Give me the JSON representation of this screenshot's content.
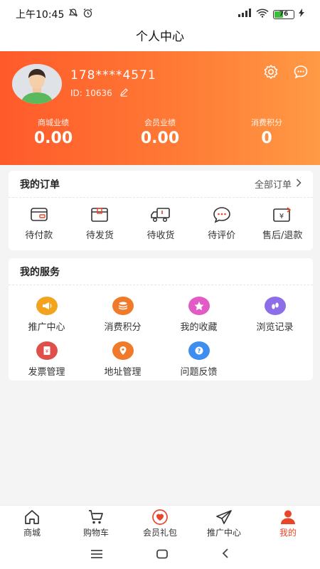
{
  "status_bar": {
    "time": "上午10:45",
    "battery": "76"
  },
  "title": "个人中心",
  "profile": {
    "phone": "178****4571",
    "id_label": "ID: 10636"
  },
  "stats": [
    {
      "label": "商城业绩",
      "value": "0.00"
    },
    {
      "label": "会员业绩",
      "value": "0.00"
    },
    {
      "label": "消费积分",
      "value": "0"
    }
  ],
  "orders": {
    "title": "我的订单",
    "all_label": "全部订单",
    "items": [
      {
        "label": "待付款",
        "icon": "wallet-icon"
      },
      {
        "label": "待发货",
        "icon": "box-icon"
      },
      {
        "label": "待收货",
        "icon": "truck-icon"
      },
      {
        "label": "待评价",
        "icon": "comment-icon"
      },
      {
        "label": "售后/退款",
        "icon": "refund-icon"
      }
    ]
  },
  "services": {
    "title": "我的服务",
    "items": [
      {
        "label": "推广中心",
        "icon": "megaphone-icon",
        "color": "#f2a41f"
      },
      {
        "label": "消费积分",
        "icon": "coins-icon",
        "color": "#f07a2a"
      },
      {
        "label": "我的收藏",
        "icon": "star-icon",
        "color": "#e25bc4"
      },
      {
        "label": "浏览记录",
        "icon": "footprint-icon",
        "color": "#8d6ee8"
      },
      {
        "label": "发票管理",
        "icon": "invoice-icon",
        "color": "#e0504b"
      },
      {
        "label": "地址管理",
        "icon": "location-icon",
        "color": "#f07a2a"
      },
      {
        "label": "问题反馈",
        "icon": "question-icon",
        "color": "#3d8ef0"
      }
    ]
  },
  "tabs": [
    {
      "label": "商城",
      "icon": "home-icon"
    },
    {
      "label": "购物车",
      "icon": "cart-icon"
    },
    {
      "label": "会员礼包",
      "icon": "gift-heart-icon"
    },
    {
      "label": "推广中心",
      "icon": "send-icon"
    },
    {
      "label": "我的",
      "icon": "user-icon",
      "active": true
    }
  ],
  "colors": {
    "accent": "#ff5a2a",
    "accent_end": "#ff9a45",
    "active_tab": "#e8452a"
  }
}
